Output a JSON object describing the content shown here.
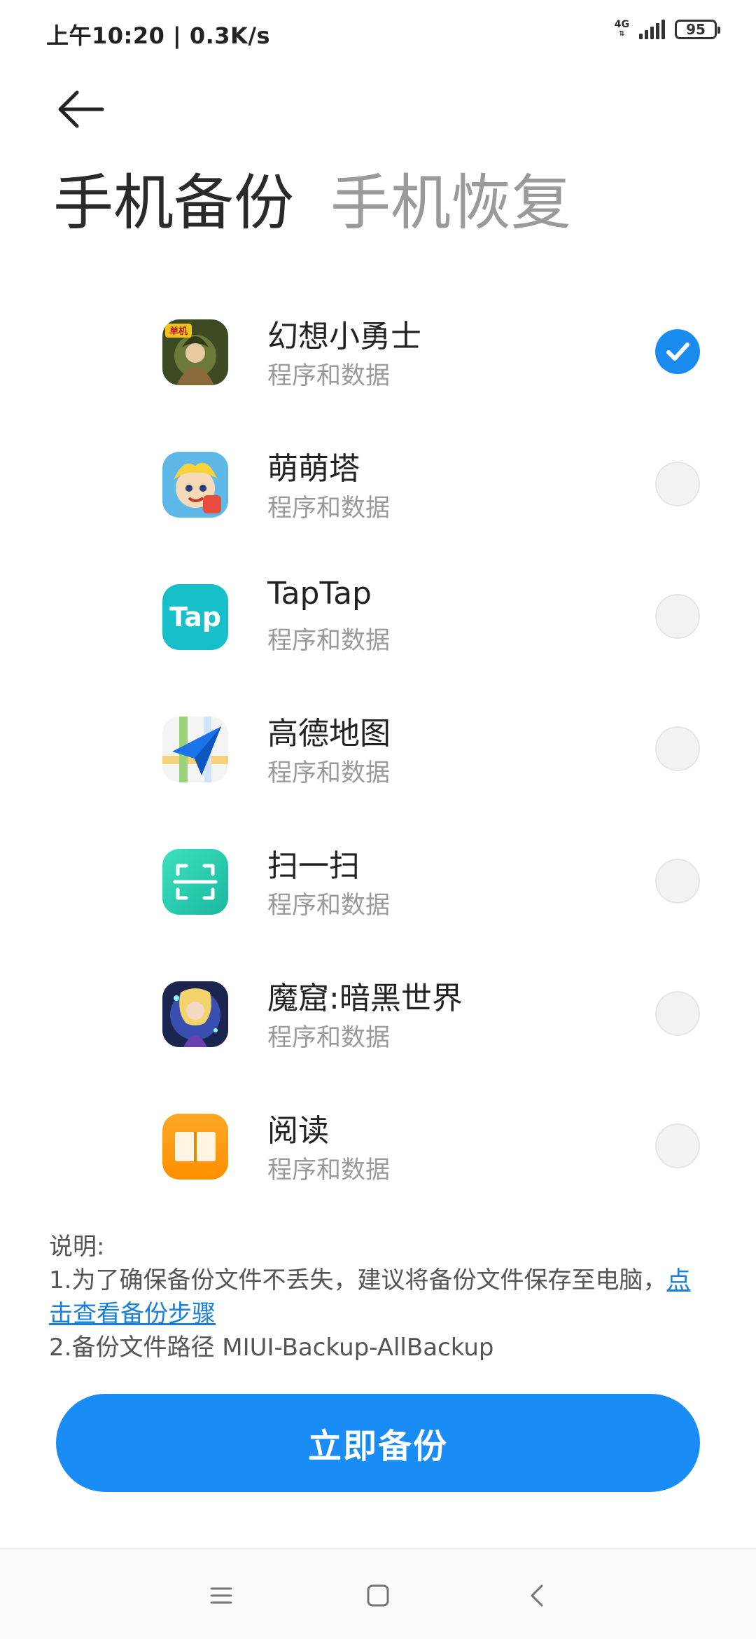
{
  "status_bar": {
    "time": "上午10:20 | 0.3K/s",
    "network": "4G",
    "battery": "95"
  },
  "header": {
    "back_icon": "arrow-left-icon",
    "tabs": [
      {
        "label": "手机备份",
        "active": true
      },
      {
        "label": "手机恢复",
        "active": false
      }
    ]
  },
  "apps": [
    {
      "name": "幻想小勇士",
      "subtitle": "程序和数据",
      "selected": true,
      "icon": "fantasy-warrior-game-icon"
    },
    {
      "name": "萌萌塔",
      "subtitle": "程序和数据",
      "selected": false,
      "icon": "cute-tower-game-icon"
    },
    {
      "name": "TapTap",
      "subtitle": "程序和数据",
      "selected": false,
      "icon": "taptap-icon",
      "icon_text": "Tap"
    },
    {
      "name": "高德地图",
      "subtitle": "程序和数据",
      "selected": false,
      "icon": "amap-icon"
    },
    {
      "name": "扫一扫",
      "subtitle": "程序和数据",
      "selected": false,
      "icon": "scanner-icon"
    },
    {
      "name": "魔窟:暗黑世界",
      "subtitle": "程序和数据",
      "selected": false,
      "icon": "dark-world-game-icon"
    },
    {
      "name": "阅读",
      "subtitle": "程序和数据",
      "selected": false,
      "icon": "reader-book-icon"
    }
  ],
  "notes": {
    "heading": "说明:",
    "line1_text": "1.为了确保备份文件不丢失，建议将备份文件保存至电脑，",
    "line1_link": "点击查看备份步骤",
    "line2": "2.备份文件路径 MIUI-Backup-AllBackup"
  },
  "primary_action": {
    "label": "立即备份"
  },
  "colors": {
    "accent": "#1a8cf5",
    "check": "#1a8cf0",
    "link": "#1a7fd8",
    "inactive_tab": "#9a9a9a"
  },
  "nav": {
    "items": [
      "menu-icon",
      "home-square-icon",
      "back-chevron-icon"
    ]
  }
}
